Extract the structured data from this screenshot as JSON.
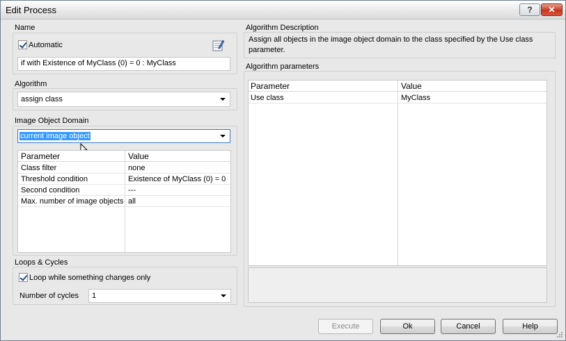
{
  "window": {
    "title": "Edit Process",
    "help_glyph": "?",
    "close_glyph": "✕"
  },
  "name_section": {
    "label": "Name",
    "automatic_label": "Automatic",
    "automatic_checked": true,
    "name_value": "if with Existence of MyClass (0) = 0  : MyClass",
    "edit_icon": "edit-name-icon"
  },
  "algorithm_section": {
    "label": "Algorithm",
    "selected": "assign class"
  },
  "domain_section": {
    "label": "Image Object Domain",
    "selected": "current image object",
    "table": {
      "headers": [
        "Parameter",
        "Value"
      ],
      "rows": [
        [
          "Class filter",
          "none"
        ],
        [
          "Threshold condition",
          "Existence of MyClass (0) = 0"
        ],
        [
          "Second condition",
          "---"
        ],
        [
          "Max. number of image objects",
          "all"
        ]
      ]
    }
  },
  "loops_section": {
    "label": "Loops & Cycles",
    "loop_label": "Loop while something changes only",
    "loop_checked": true,
    "cycles_label": "Number of cycles",
    "cycles_value": "1"
  },
  "description_section": {
    "label": "Algorithm Description",
    "text": "Assign all objects in the image object domain to the class specified by the Use class parameter."
  },
  "parameters_section": {
    "label": "Algorithm parameters",
    "table": {
      "headers": [
        "Parameter",
        "Value"
      ],
      "rows": [
        [
          "Use class",
          "MyClass"
        ]
      ]
    }
  },
  "buttons": {
    "execute": "Execute",
    "ok": "Ok",
    "cancel": "Cancel",
    "help": "Help"
  },
  "colors": {
    "selection": "#3399ff",
    "close_button": "#c43a20"
  }
}
